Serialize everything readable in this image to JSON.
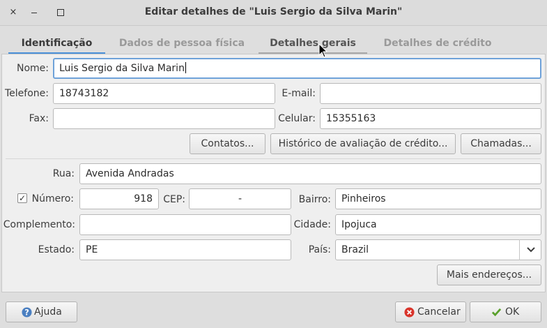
{
  "window": {
    "title": "Editar detalhes de \"Luis Sergio da Silva Marin\"",
    "close_icon": "×"
  },
  "tabs": [
    {
      "label": "Identificação"
    },
    {
      "label": "Dados de pessoa física"
    },
    {
      "label": "Detalhes gerais"
    },
    {
      "label": "Detalhes de crédito"
    }
  ],
  "form": {
    "nome_label": "Nome:",
    "nome_value": "Luis Sergio da Silva Marin",
    "telefone_label": "Telefone:",
    "telefone_value": "18743182",
    "email_label": "E-mail:",
    "email_value": "",
    "fax_label": "Fax:",
    "fax_value": "",
    "celular_label": "Celular:",
    "celular_value": "15355163"
  },
  "buttons": {
    "contatos": "Contatos...",
    "historico": "Histórico de avaliação de crédito...",
    "chamadas": "Chamadas...",
    "mais_enderecos": "Mais endereços...",
    "ajuda": "Ajuda",
    "cancelar": "Cancelar",
    "ok": "OK"
  },
  "address": {
    "rua_label": "Rua:",
    "rua_value": "Avenida Andradas",
    "numero_label": "Número:",
    "numero_checked": true,
    "check_glyph": "✓",
    "numero_value": "918",
    "cep_label": "CEP:",
    "cep_value": "-",
    "bairro_label": "Bairro:",
    "bairro_value": "Pinheiros",
    "complemento_label": "Complemento:",
    "complemento_value": "",
    "cidade_label": "Cidade:",
    "cidade_value": "Ipojuca",
    "estado_label": "Estado:",
    "estado_value": "PE",
    "pais_label": "País:",
    "pais_value": "Brazil"
  },
  "colors": {
    "accent_tab": "#4a90d9",
    "focus_border": "#6fa2d9",
    "cancel_icon": "#d9342b",
    "ok_icon": "#5aa02c",
    "help_icon": "#4a7fc1"
  }
}
